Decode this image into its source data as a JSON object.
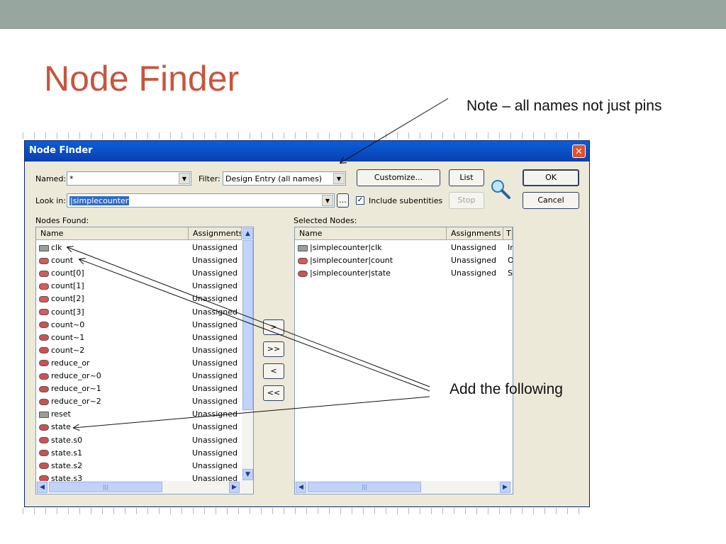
{
  "slide": {
    "title": "Node Finder",
    "note": "Note – all names not just pins",
    "add_text": "Add the following",
    "topbar_color": "#97a79f",
    "title_color": "#c8553d"
  },
  "dialog": {
    "title": "Node Finder",
    "close_icon": "close-icon",
    "named_label": "Named:",
    "named_value": "*",
    "filter_label": "Filter:",
    "filter_value": "Design Entry (all names)",
    "customize_label": "Customize...",
    "list_label": "List",
    "ok_label": "OK",
    "lookin_label": "Look in:",
    "lookin_value": "|simplecounter",
    "browse_label": "...",
    "include_subentities_label": "Include subentities",
    "include_subentities_checked": true,
    "stop_label": "Stop",
    "cancel_label": "Cancel",
    "nodes_found_label": "Nodes Found:",
    "selected_nodes_label": "Selected Nodes:",
    "search_icon": "magnifier-icon",
    "move_buttons": [
      ">",
      ">>",
      "<",
      "<<"
    ]
  },
  "nodes_found": {
    "columns": [
      "Name",
      "Assignments"
    ],
    "rows": [
      {
        "icon": "in",
        "name": "clk",
        "assignment": "Unassigned"
      },
      {
        "icon": "out",
        "name": "count",
        "assignment": "Unassigned"
      },
      {
        "icon": "out",
        "name": "count[0]",
        "assignment": "Unassigned"
      },
      {
        "icon": "out",
        "name": "count[1]",
        "assignment": "Unassigned"
      },
      {
        "icon": "out",
        "name": "count[2]",
        "assignment": "Unassigned"
      },
      {
        "icon": "out",
        "name": "count[3]",
        "assignment": "Unassigned"
      },
      {
        "icon": "st",
        "name": "count~0",
        "assignment": "Unassigned"
      },
      {
        "icon": "st",
        "name": "count~1",
        "assignment": "Unassigned"
      },
      {
        "icon": "st",
        "name": "count~2",
        "assignment": "Unassigned"
      },
      {
        "icon": "st",
        "name": "reduce_or",
        "assignment": "Unassigned"
      },
      {
        "icon": "st",
        "name": "reduce_or~0",
        "assignment": "Unassigned"
      },
      {
        "icon": "st",
        "name": "reduce_or~1",
        "assignment": "Unassigned"
      },
      {
        "icon": "st",
        "name": "reduce_or~2",
        "assignment": "Unassigned"
      },
      {
        "icon": "in",
        "name": "reset",
        "assignment": "Unassigned"
      },
      {
        "icon": "st",
        "name": "state",
        "assignment": "Unassigned"
      },
      {
        "icon": "st",
        "name": "state.s0",
        "assignment": "Unassigned"
      },
      {
        "icon": "st",
        "name": "state.s1",
        "assignment": "Unassigned"
      },
      {
        "icon": "st",
        "name": "state.s2",
        "assignment": "Unassigned"
      },
      {
        "icon": "st",
        "name": "state.s3",
        "assignment": "Unassigned"
      }
    ]
  },
  "selected_nodes": {
    "columns": [
      "Name",
      "Assignments",
      "T"
    ],
    "rows": [
      {
        "icon": "in",
        "name": "|simplecounter|clk",
        "assignment": "Unassigned",
        "type": "Ir"
      },
      {
        "icon": "out",
        "name": "|simplecounter|count",
        "assignment": "Unassigned",
        "type": "O"
      },
      {
        "icon": "st",
        "name": "|simplecounter|state",
        "assignment": "Unassigned",
        "type": "S"
      }
    ]
  }
}
